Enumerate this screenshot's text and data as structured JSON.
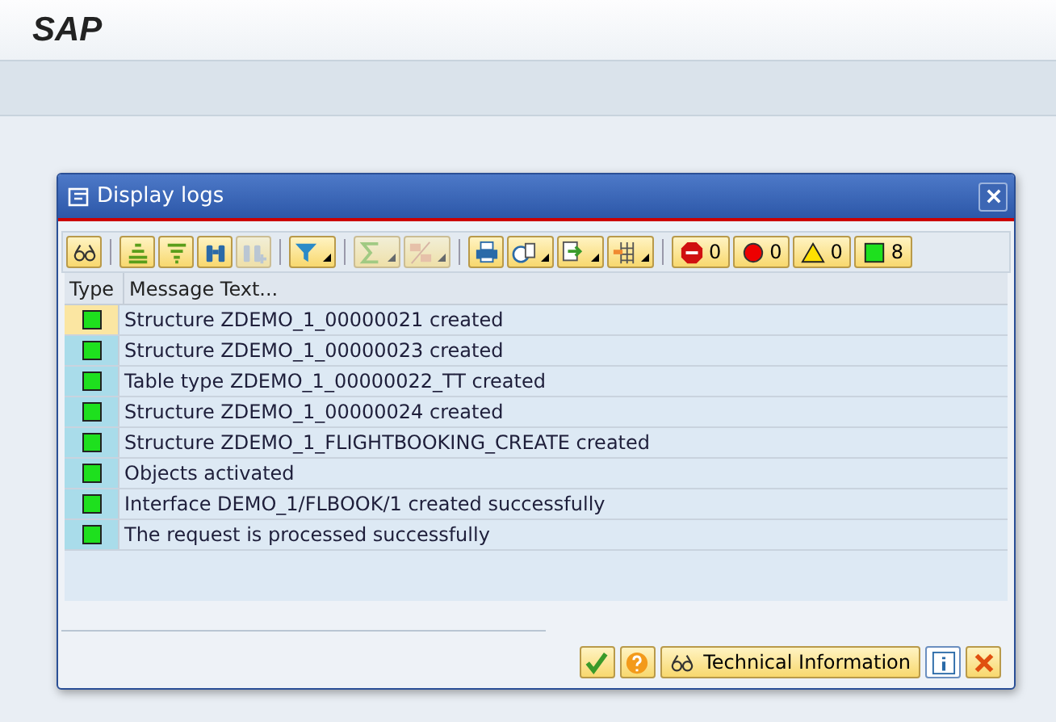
{
  "header": {
    "logo": "SAP"
  },
  "dialog": {
    "title": "Display logs",
    "toolbar": [
      {
        "kind": "display",
        "disabled": false,
        "dropdown": false
      },
      {
        "kind": "sort_up",
        "disabled": false,
        "dropdown": false
      },
      {
        "kind": "sort_down",
        "disabled": false,
        "dropdown": false
      },
      {
        "kind": "find",
        "disabled": false,
        "dropdown": false
      },
      {
        "kind": "find_next",
        "disabled": true,
        "dropdown": false
      },
      {
        "kind": "filter",
        "disabled": false,
        "dropdown": true
      },
      {
        "kind": "sum",
        "disabled": true,
        "dropdown": true
      },
      {
        "kind": "subtotal",
        "disabled": true,
        "dropdown": true
      },
      {
        "kind": "print",
        "disabled": false,
        "dropdown": false
      },
      {
        "kind": "views",
        "disabled": false,
        "dropdown": true
      },
      {
        "kind": "export",
        "disabled": false,
        "dropdown": true
      },
      {
        "kind": "layout",
        "disabled": false,
        "dropdown": true
      }
    ],
    "counters": [
      {
        "kind": "stop",
        "count": "0"
      },
      {
        "kind": "error",
        "count": "0"
      },
      {
        "kind": "warning",
        "count": "0"
      },
      {
        "kind": "success",
        "count": "8"
      }
    ],
    "columns": [
      "Type",
      "Message Text..."
    ],
    "rows": [
      {
        "kind": "success",
        "text": "Structure ZDEMO_1_00000021 created",
        "selected": true
      },
      {
        "kind": "success",
        "text": "Structure ZDEMO_1_00000023 created",
        "selected": false
      },
      {
        "kind": "success",
        "text": "Table type ZDEMO_1_00000022_TT created",
        "selected": false
      },
      {
        "kind": "success",
        "text": "Structure ZDEMO_1_00000024 created",
        "selected": false
      },
      {
        "kind": "success",
        "text": "Structure ZDEMO_1_FLIGHTBOOKING_CREATE created",
        "selected": false
      },
      {
        "kind": "success",
        "text": "Objects activated",
        "selected": false
      },
      {
        "kind": "success",
        "text": "Interface DEMO_1/FLBOOK/1 created successfully",
        "selected": false
      },
      {
        "kind": "success",
        "text": "The request is processed successfully",
        "selected": false
      }
    ],
    "footer": {
      "technical_button": "Technical Information"
    }
  }
}
